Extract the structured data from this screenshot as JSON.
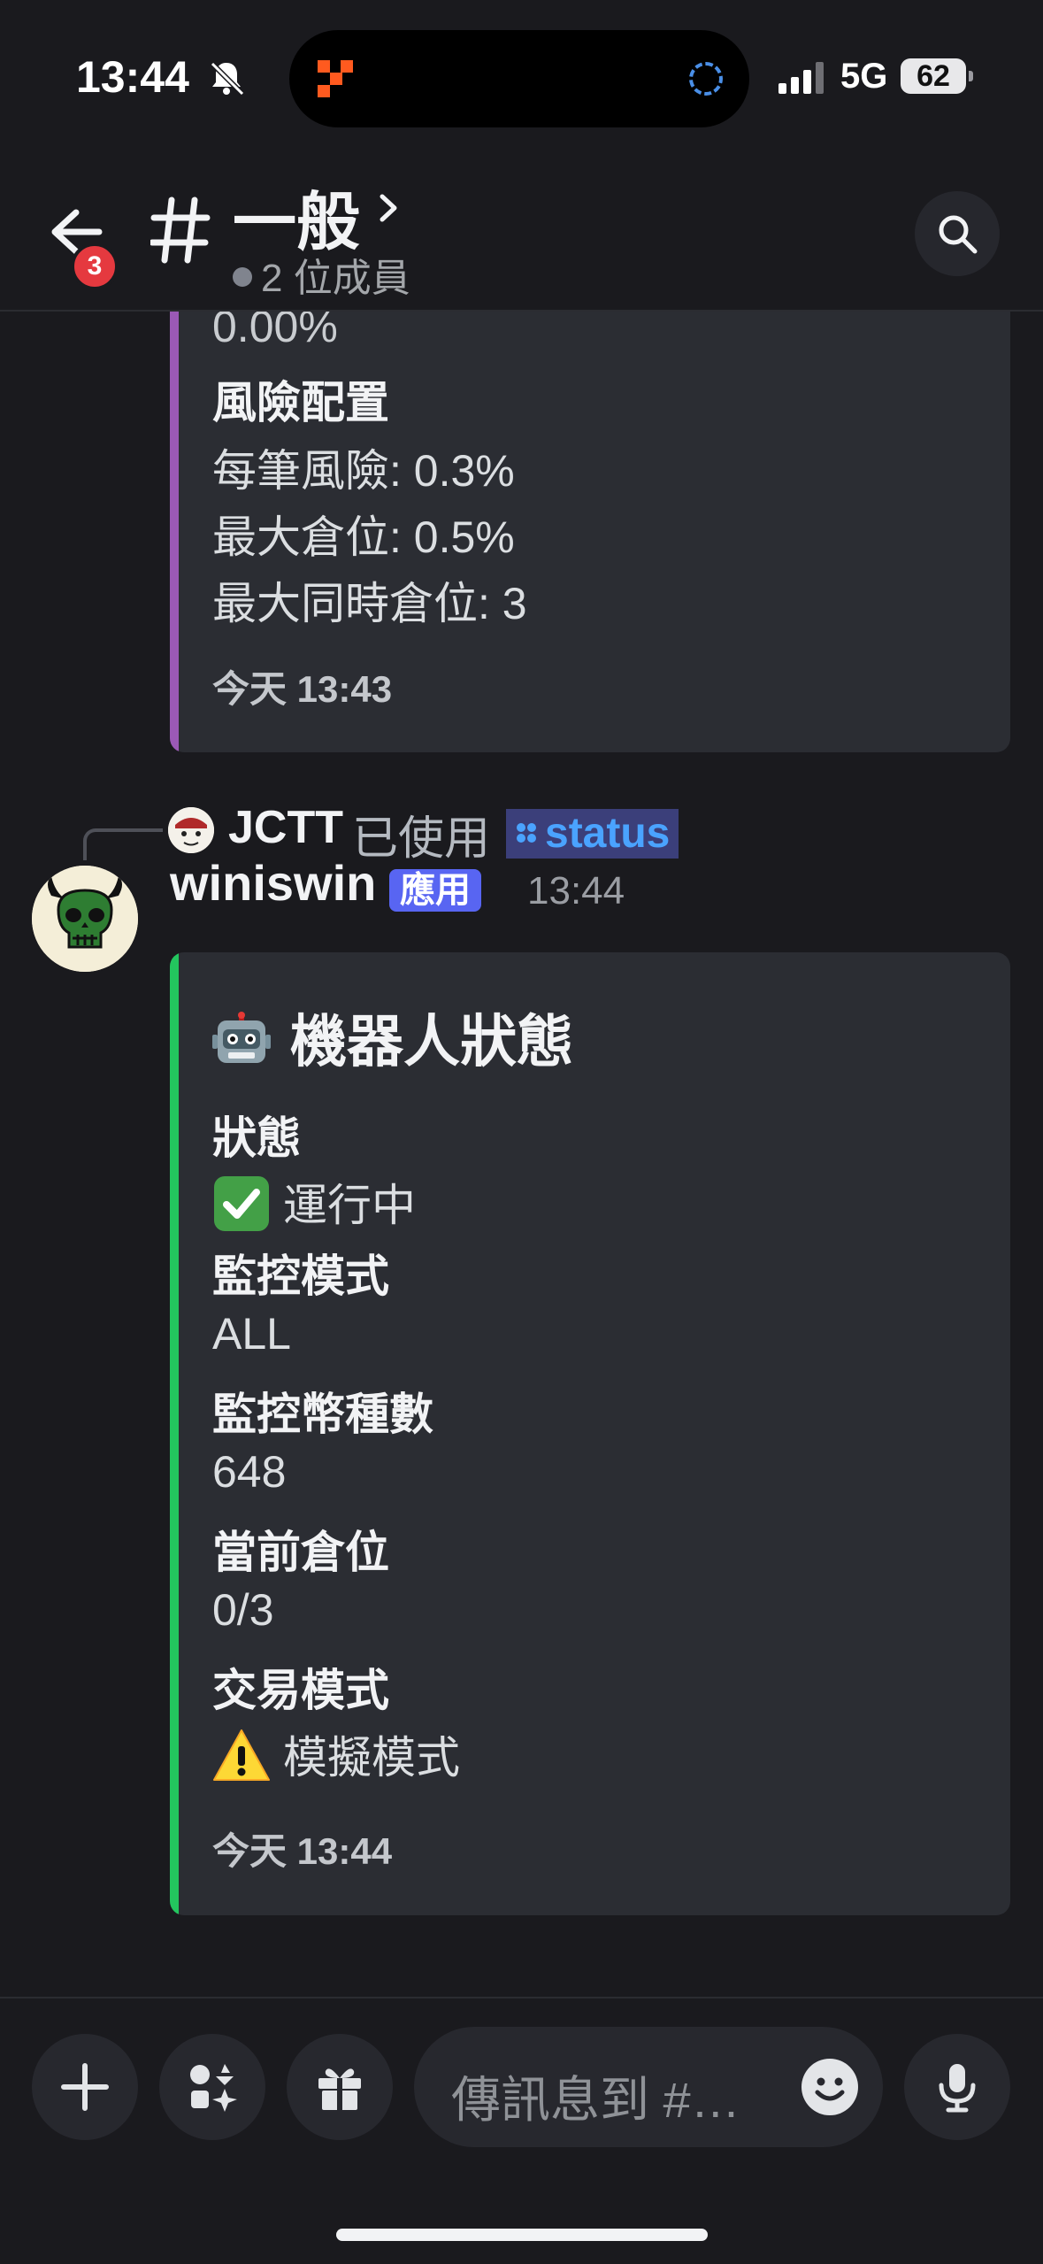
{
  "status_bar": {
    "time": "13:44",
    "network": "5G",
    "battery": "62",
    "icons": [
      "bell-slash-icon",
      "signal-icon"
    ]
  },
  "header": {
    "channel_name": "一般",
    "members_text": "2 位成員",
    "unread_badge": "3",
    "icons": [
      "back-arrow-icon",
      "hash-icon",
      "chevron-right-icon",
      "search-icon"
    ]
  },
  "prev_embed": {
    "accent_color": "#9b59b6",
    "partial_value": "0.00%",
    "field_name": "風險配置",
    "lines": [
      "每筆風險: 0.3%",
      "最大倉位: 0.5%",
      "最大同時倉位: 3"
    ],
    "footer": "今天 13:43"
  },
  "reply": {
    "user": "JCTT",
    "used_text": "已使用",
    "command": "status"
  },
  "message": {
    "author": "winiswin",
    "app_tag": "應用",
    "time": "13:44",
    "embed": {
      "accent_color": "#23c55e",
      "title": "機器人狀態",
      "title_icon": "robot-icon",
      "fields": [
        {
          "name": "狀態",
          "value": "運行中",
          "icon": "check-box-icon"
        },
        {
          "name": "監控模式",
          "value": "ALL"
        },
        {
          "name": "監控幣種數",
          "value": "648"
        },
        {
          "name": "當前倉位",
          "value": "0/3"
        },
        {
          "name": "交易模式",
          "value": "模擬模式",
          "icon": "warning-icon"
        }
      ],
      "footer": "今天 13:44"
    }
  },
  "composer": {
    "placeholder": "傳訊息到 #…",
    "icons": [
      "plus-icon",
      "apps-icon",
      "gift-icon",
      "emoji-icon",
      "microphone-icon"
    ]
  }
}
